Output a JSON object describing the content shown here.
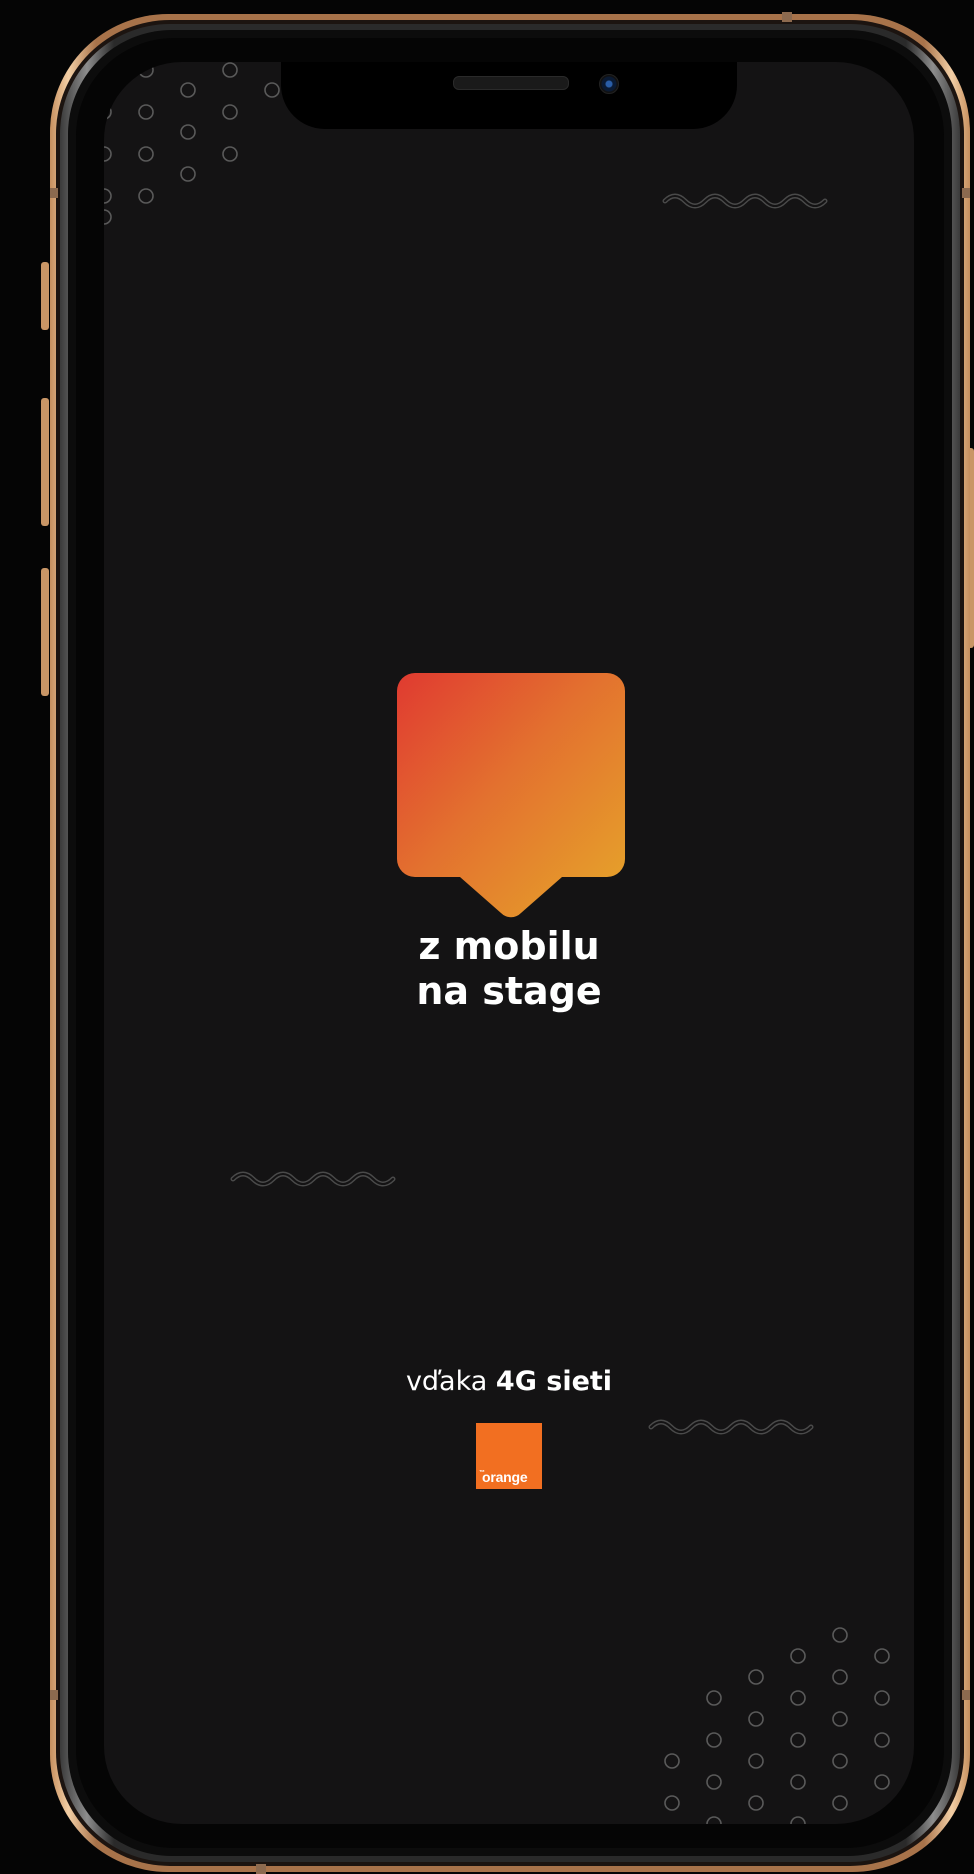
{
  "app": {
    "headline_line1": "z mobilu",
    "headline_line2": "na stage",
    "tagline_prefix": "vďaka",
    "tagline_bold": "4G sieti",
    "brand_logo_text": "orange",
    "brand_logo_mark": "™"
  },
  "icons": {
    "app_logo": "speech-bubble-logo-icon",
    "brand_logo": "orange-logo-icon"
  },
  "colors": {
    "screen_background": "#141314",
    "logo_gradient_start": "#e03a30",
    "logo_gradient_end": "#e6a72a",
    "brand_orange": "#f26f21",
    "text": "#ffffff"
  }
}
